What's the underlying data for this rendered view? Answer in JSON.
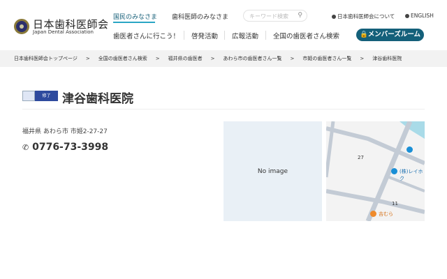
{
  "logo": {
    "ja": "日本歯科医師会",
    "en": "Japan Dental Association"
  },
  "header": {
    "tabs": [
      {
        "label": "国民のみなさま",
        "active": true
      },
      {
        "label": "歯科医師のみなさま",
        "active": false
      }
    ],
    "search_placeholder": "キーワード検索",
    "utility": [
      "日本歯科医師会について",
      "ENGLISH"
    ],
    "nav": [
      "歯医者さんに行こう！",
      "啓発活動",
      "広報活動",
      "全国の歯医者さん検索"
    ],
    "member_button": "メンバーズルーム",
    "accent": "#14607a"
  },
  "breadcrumb": [
    "日本歯科医師会トップページ",
    "全国の歯医者さん検索",
    "福井県の歯医者",
    "あわら市の歯医者さん一覧",
    "市姫の歯医者さん一覧",
    "津谷歯科医院"
  ],
  "breadcrumb_sep": ">",
  "clinic": {
    "badge": "修了",
    "name": "津谷歯科医院",
    "address": "福井県 あわら市 市姫2-27-27",
    "phone": "0776-73-3998",
    "no_image": "No image"
  },
  "map": {
    "labels": [
      "27",
      "11"
    ],
    "pois": [
      "(株)レイホク",
      "吉むら"
    ]
  }
}
